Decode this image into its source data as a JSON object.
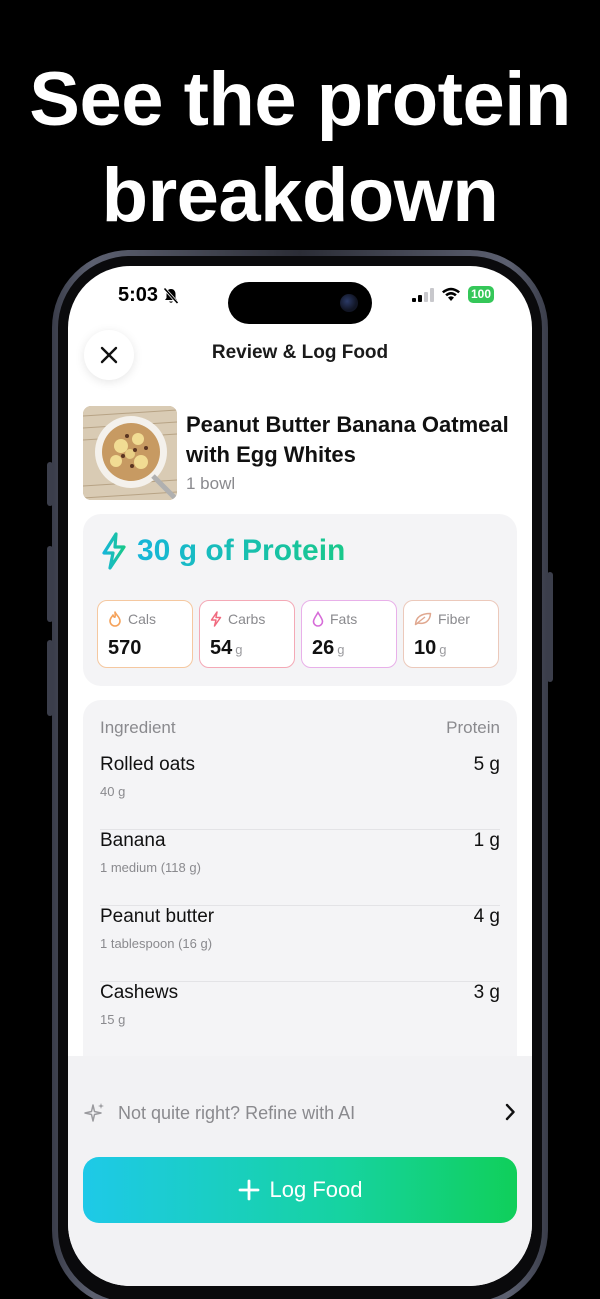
{
  "headline": {
    "line1": "See the protein",
    "line2": "breakdown"
  },
  "status_bar": {
    "time": "5:03",
    "battery": "100"
  },
  "header": {
    "title": "Review & Log Food"
  },
  "food": {
    "name": "Peanut Butter Banana Oatmeal with Egg Whites",
    "serving": "1 bowl"
  },
  "protein": {
    "label": "30 g of Protein"
  },
  "macros": [
    {
      "label": "Cals",
      "value": "570",
      "unit": "",
      "color": "#f5a35c",
      "icon": "flame-icon"
    },
    {
      "label": "Carbs",
      "value": "54",
      "unit": "g",
      "color": "#f06a7f",
      "icon": "bolt-icon"
    },
    {
      "label": "Fats",
      "value": "26",
      "unit": "g",
      "color": "#d66bd8",
      "icon": "drop-icon"
    },
    {
      "label": "Fiber",
      "value": "10",
      "unit": "g",
      "color": "#e0a890",
      "icon": "leaf-icon"
    }
  ],
  "ingredients": {
    "col_ingredient": "Ingredient",
    "col_protein": "Protein",
    "rows": [
      {
        "name": "Rolled oats",
        "amount": "40 g",
        "protein": "5 g"
      },
      {
        "name": "Banana",
        "amount": "1 medium (118 g)",
        "protein": "1 g"
      },
      {
        "name": "Peanut butter",
        "amount": "1 tablespoon (16 g)",
        "protein": "4 g"
      },
      {
        "name": "Cashews",
        "amount": "15 g",
        "protein": "3 g"
      }
    ]
  },
  "refine": {
    "label": "Not quite right? Refine with AI"
  },
  "log_button": {
    "label": "Log Food"
  },
  "colors": {
    "accent_start": "#1ec9e8",
    "accent_end": "#10cf5a",
    "protein": "#17c3b2"
  }
}
